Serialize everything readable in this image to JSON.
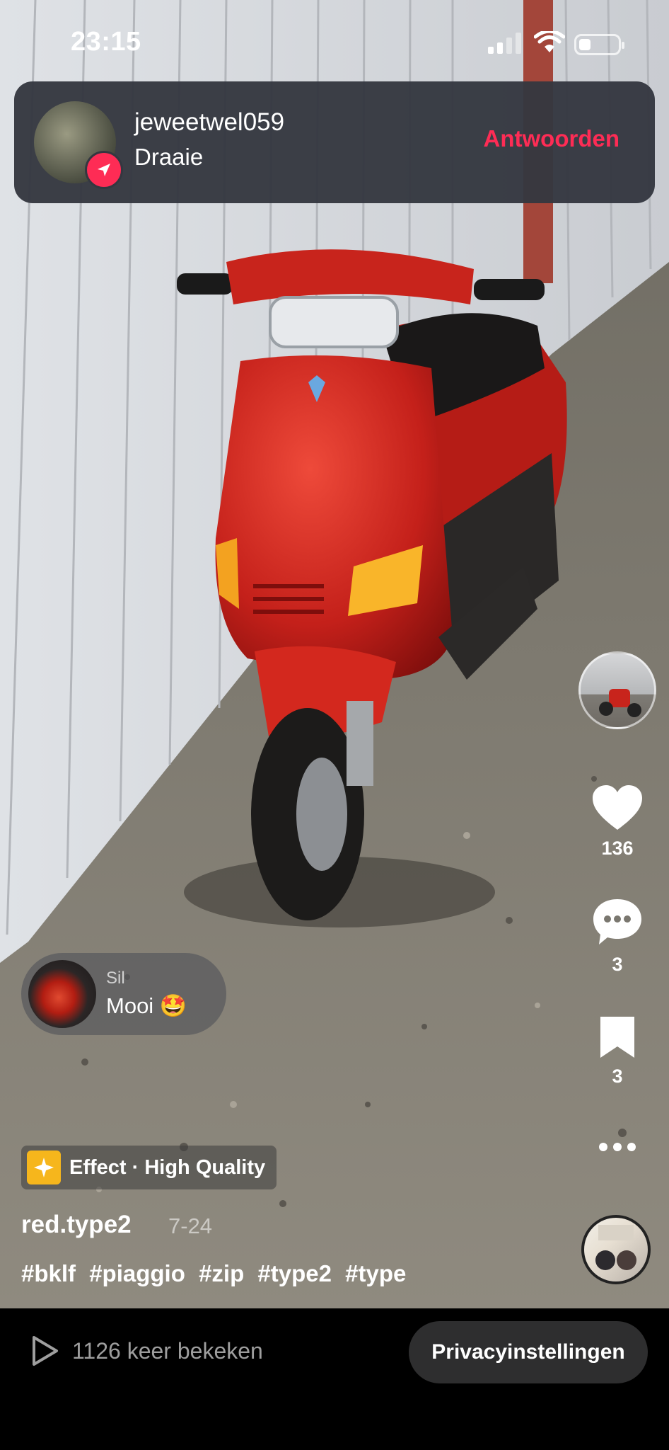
{
  "status_bar": {
    "time": "23:15",
    "battery_level": 0.3
  },
  "notification": {
    "username": "jeweetwel059",
    "message": "Draaie",
    "reply_label": "Antwoorden",
    "accent_color": "#fe2c55"
  },
  "actions": {
    "likes": "136",
    "comments": "3",
    "bookmarks": "3"
  },
  "comment_bubble": {
    "username": "Sil",
    "text": "Mooi 🤩"
  },
  "effect": {
    "label": "Effect · High Quality"
  },
  "post": {
    "author": "red.type2",
    "date": "7-24",
    "hashtags": [
      "#bklf",
      "#piaggio",
      "#zip",
      "#type2",
      "#type"
    ]
  },
  "bottom_bar": {
    "views": "1126 keer bekeken",
    "privacy_label": "Privacyinstellingen"
  },
  "icons": [
    "play-icon",
    "heart-icon",
    "comment-icon",
    "bookmark-icon",
    "more-icon",
    "reply-arrow-icon",
    "effect-sparkle-icon",
    "wifi-icon",
    "signal-icon",
    "battery-icon"
  ]
}
